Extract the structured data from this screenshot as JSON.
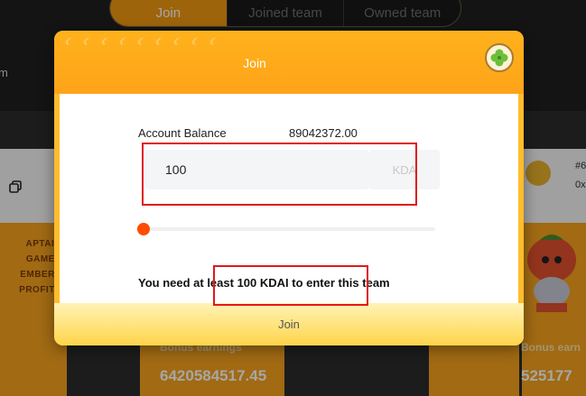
{
  "tabs": [
    {
      "label": "Join",
      "active": true
    },
    {
      "label": "Joined team",
      "active": false
    },
    {
      "label": "Owned team",
      "active": false
    }
  ],
  "background": {
    "left_fragment": "m",
    "captain_lines": [
      "APTAIN",
      "GAMES",
      "EMBERS",
      "PROFITS"
    ],
    "team_id_fragment": "#6",
    "address_fragment": "0x",
    "bonus_label_1": "Bonus earnings",
    "bonus_value_1": "6420584517.45",
    "bonus_label_2": "Bonus earn",
    "bonus_value_2": "525177"
  },
  "modal": {
    "title": "Join",
    "balance_label": "Account Balance",
    "balance_value": "89042372.00",
    "amount_value": "100",
    "unit": "KDA",
    "slider_fraction": 0.0,
    "notice": "You need at least 100 KDAI to enter this team",
    "join_label": "Join"
  },
  "icons": {
    "close": "clover-close-icon",
    "copy": "copy-icon"
  },
  "colors": {
    "accent": "#f39a12",
    "slider": "#ff4d00",
    "annotation": "#e0191b"
  }
}
